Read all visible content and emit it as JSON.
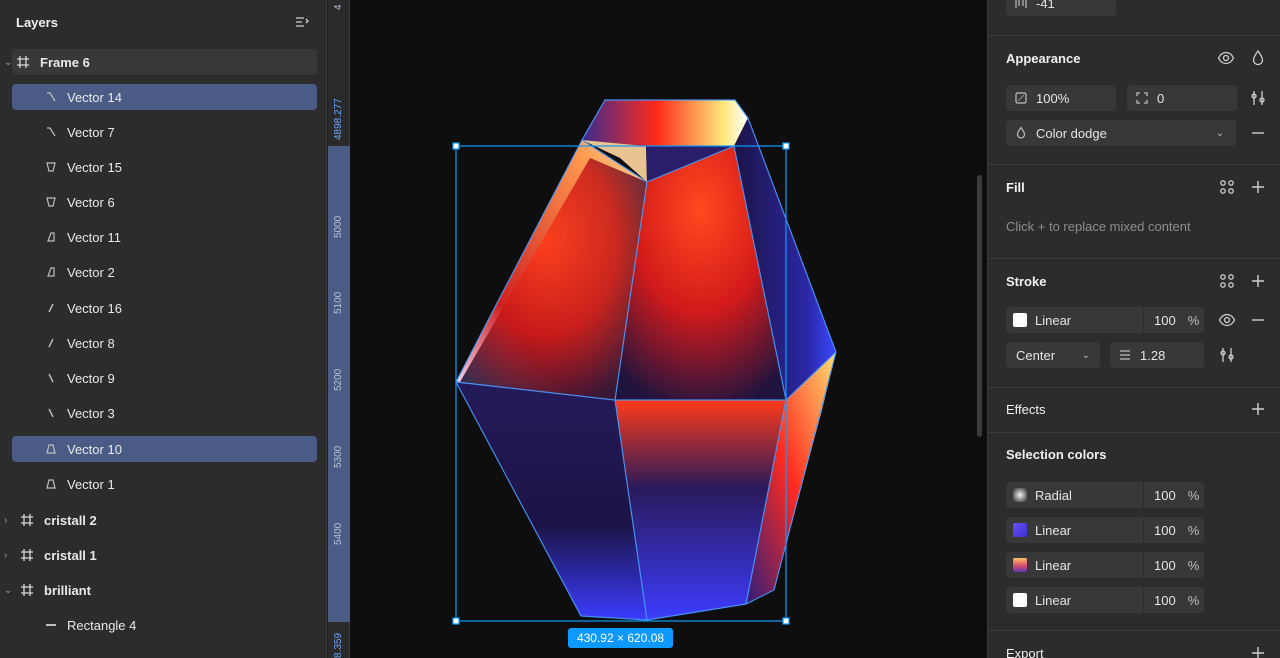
{
  "layers": {
    "title": "Layers",
    "items": [
      {
        "label": "Frame 6",
        "type": "frame"
      },
      {
        "label": "Vector 14",
        "type": "vector"
      },
      {
        "label": "Vector 7",
        "type": "vector"
      },
      {
        "label": "Vector 15",
        "type": "vector"
      },
      {
        "label": "Vector 6",
        "type": "vector"
      },
      {
        "label": "Vector 11",
        "type": "vector"
      },
      {
        "label": "Vector 2",
        "type": "vector"
      },
      {
        "label": "Vector 16",
        "type": "vector"
      },
      {
        "label": "Vector 8",
        "type": "vector"
      },
      {
        "label": "Vector 9",
        "type": "vector"
      },
      {
        "label": "Vector 3",
        "type": "vector"
      },
      {
        "label": "Vector 10",
        "type": "vector"
      },
      {
        "label": "Vector 1",
        "type": "vector"
      },
      {
        "label": "cristall 2",
        "type": "frame"
      },
      {
        "label": "cristall 1",
        "type": "frame"
      },
      {
        "label": "brilliant",
        "type": "frame"
      },
      {
        "label": "Rectangle 4",
        "type": "rect"
      }
    ]
  },
  "ruler": {
    "labels": [
      "4",
      "4898.277",
      "5000",
      "5100",
      "5200",
      "5300",
      "5400",
      "8.359"
    ]
  },
  "canvas": {
    "dimensions": "430.92 × 620.08"
  },
  "props": {
    "top_value": "-41",
    "appearance": {
      "title": "Appearance",
      "opacity": "100%",
      "radius": "0",
      "blend": "Color dodge"
    },
    "fill": {
      "title": "Fill",
      "hint": "Click + to replace mixed content"
    },
    "stroke": {
      "title": "Stroke",
      "paint": "Linear",
      "opacity": "100",
      "percent": "%",
      "align": "Center",
      "weight": "1.28"
    },
    "effects": {
      "title": "Effects"
    },
    "selection_colors": {
      "title": "Selection colors",
      "items": [
        {
          "label": "Radial",
          "opacity": "100",
          "percent": "%"
        },
        {
          "label": "Linear",
          "opacity": "100",
          "percent": "%"
        },
        {
          "label": "Linear",
          "opacity": "100",
          "percent": "%"
        },
        {
          "label": "Linear",
          "opacity": "100",
          "percent": "%"
        }
      ]
    },
    "export": {
      "title": "Export"
    }
  },
  "colors": {
    "selection": "#4a5c86",
    "accent": "#0d99ff"
  }
}
